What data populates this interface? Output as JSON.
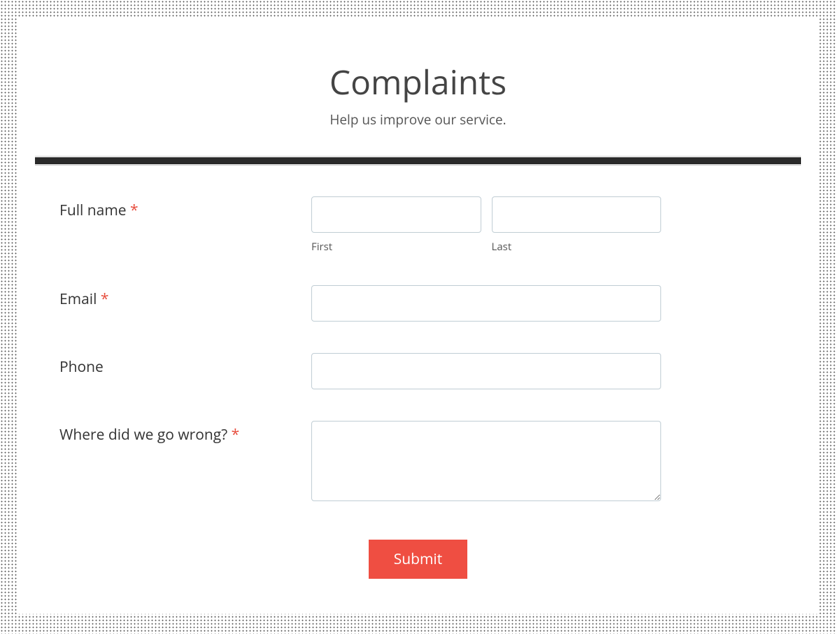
{
  "header": {
    "title": "Complaints",
    "subtitle": "Help us improve our service."
  },
  "fields": {
    "full_name": {
      "label": "Full name ",
      "required": "*",
      "first_sublabel": "First",
      "last_sublabel": "Last"
    },
    "email": {
      "label": "Email ",
      "required": "*"
    },
    "phone": {
      "label": "Phone"
    },
    "complaint": {
      "label": "Where did we go wrong? ",
      "required": "*"
    }
  },
  "submit": {
    "label": "Submit"
  }
}
